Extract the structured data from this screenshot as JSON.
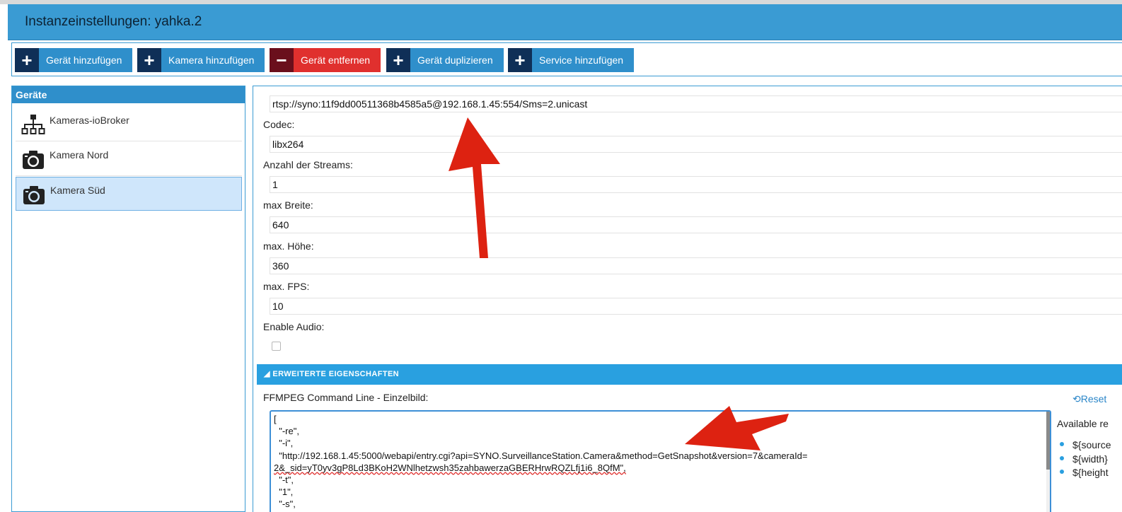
{
  "header": {
    "title": "Instanzeinstellungen: yahka.2"
  },
  "toolbar": {
    "buttons": [
      {
        "icon": "plus-icon",
        "label": "Gerät hinzufügen"
      },
      {
        "icon": "plus-icon",
        "label": "Kamera hinzufügen"
      },
      {
        "icon": "minus-icon",
        "label": "Gerät entfernen"
      },
      {
        "icon": "plus-icon",
        "label": "Gerät duplizieren"
      },
      {
        "icon": "plus-icon",
        "label": "Service hinzufügen"
      }
    ]
  },
  "sidebar": {
    "title": "Geräte",
    "items": [
      {
        "icon": "network-hierarchy-icon",
        "label": "Kameras-ioBroker",
        "selected": false
      },
      {
        "icon": "camera-icon",
        "label": "Kamera Nord",
        "selected": false
      },
      {
        "icon": "camera-icon",
        "label": "Kamera Süd",
        "selected": true
      }
    ]
  },
  "form": {
    "source_value": "rtsp://syno:11f9dd00511368b4585a5@192.168.1.45:554/Sms=2.unicast",
    "codec_label": "Codec:",
    "codec_value": "libx264",
    "streams_label": "Anzahl der Streams:",
    "streams_value": "1",
    "width_label": "max Breite:",
    "width_value": "640",
    "height_label": "max. Höhe:",
    "height_value": "360",
    "fps_label": "max. FPS:",
    "fps_value": "10",
    "audio_label": "Enable Audio:",
    "audio_checked": false
  },
  "advanced": {
    "section_title": "ERWEITERTE EIGENSCHAFTEN",
    "ffmpeg_label": "FFMPEG Command Line - Einzelbild:",
    "reset_label": "Reset",
    "command_lines": [
      "[",
      "  \"-re\",",
      "  \"-i\",",
      "  \"http://192.168.1.45:5000/webapi/entry.cgi?api=SYNO.SurveillanceStation.Camera&method=GetSnapshot&version=7&cameraId=",
      "2&_sid=yT0yv3gP8Ld3BKoH2WNlhetzwsh35zahbawerzaGBERHrwRQZLfj1i6_8QfM\",",
      "  \"-t\",",
      "  \"1\",",
      "  \"-s\","
    ],
    "available_title": "Available re",
    "variables": [
      "${source",
      "${width}",
      "${height"
    ]
  },
  "colors": {
    "header_blue": "#3a9bd3",
    "button_blue": "#2f8fcb",
    "button_red": "#e0302e",
    "annotation_arrow": "#dd2211"
  }
}
